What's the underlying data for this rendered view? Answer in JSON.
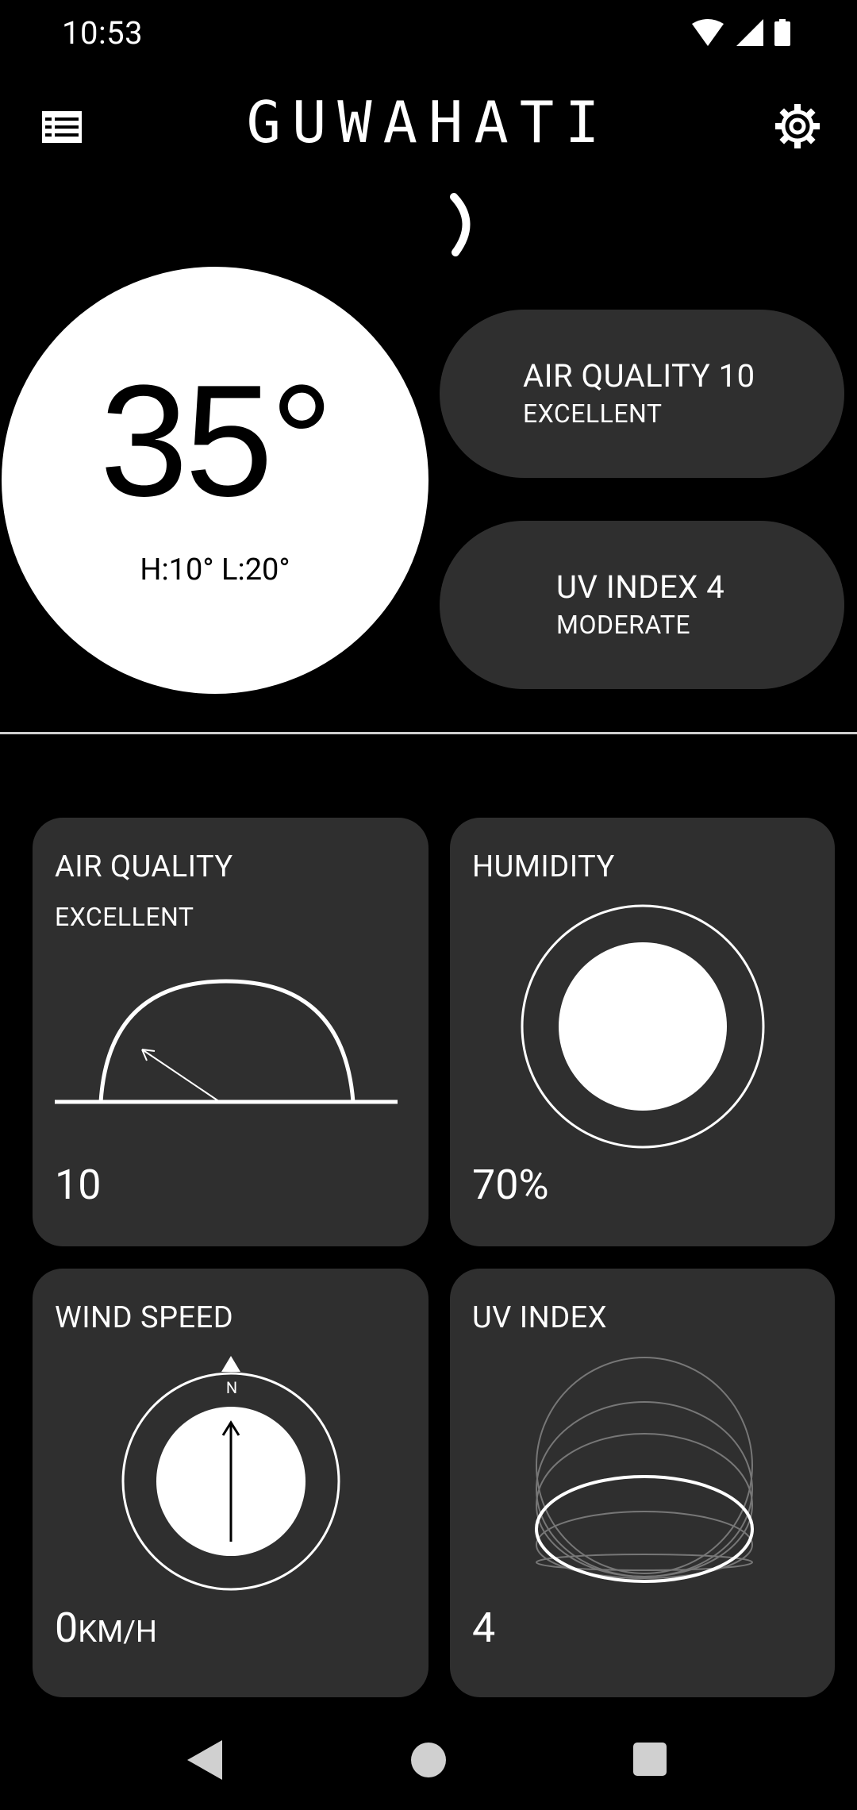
{
  "status_bar": {
    "time": "10:53"
  },
  "header": {
    "city": "GUWAHATI"
  },
  "current": {
    "temperature": "35°",
    "high_low": "H:10° L:20°"
  },
  "pills": {
    "air_quality": {
      "title": "AIR QUALITY 10",
      "subtitle": "EXCELLENT"
    },
    "uv_index": {
      "title": "UV INDEX 4",
      "subtitle": "MODERATE"
    }
  },
  "cards": {
    "air_quality": {
      "title": "AIR QUALITY",
      "subtitle": "EXCELLENT",
      "value": "10"
    },
    "humidity": {
      "title": "HUMIDITY",
      "value": "70%"
    },
    "wind_speed": {
      "title": "WIND SPEED",
      "value": "0",
      "unit": "KM/H",
      "compass_label": "N"
    },
    "uv_index": {
      "title": "UV INDEX",
      "value": "4"
    }
  },
  "icons": {
    "menu": "list-icon",
    "settings": "gear-icon",
    "loading": "loading-spinner-icon",
    "back": "back-triangle-icon",
    "home": "home-circle-icon",
    "recents": "recents-square-icon"
  },
  "colors": {
    "background": "#000000",
    "card": "#2f2f2f",
    "foreground": "#ffffff"
  }
}
